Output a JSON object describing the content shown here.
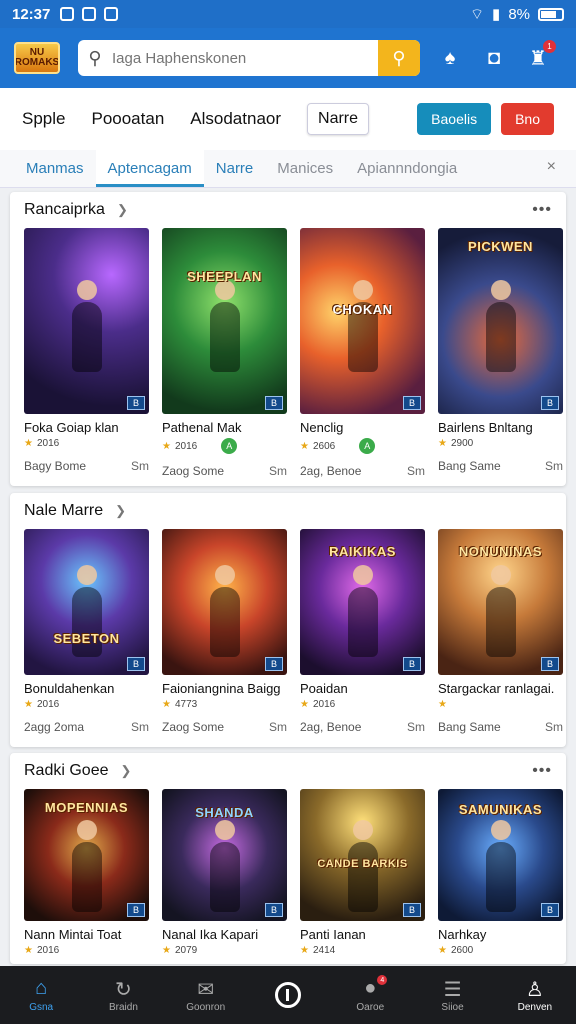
{
  "status_bar": {
    "time": "12:37",
    "battery": "8%"
  },
  "header": {
    "logo_text": "NU ROMAKS",
    "search_placeholder": "Iaga Haphenskonen",
    "icons": [
      "bell-icon",
      "notification-icon",
      "profile-icon"
    ],
    "profile_badge": "1"
  },
  "top_nav": {
    "links": [
      "Spple",
      "Poooatan",
      "Alsodatnaor"
    ],
    "outline_link": "Narre",
    "button_a": "Baoelis",
    "button_b": "Bno"
  },
  "tabs": {
    "items": [
      "Manmas",
      "Aptencagam",
      "Narre",
      "Manices",
      "Apiannndongia"
    ],
    "active_index": 1,
    "close": "×"
  },
  "sections": [
    {
      "title": "Rancaiprka",
      "cards": [
        {
          "title": "Foka Goiap klan",
          "year": "2016",
          "meta": "Bagy Bome",
          "size": "Sm",
          "corner": "B",
          "chip": "",
          "art_title": ""
        },
        {
          "title": "Pathenal Mak",
          "year": "2016",
          "meta": "Zaog Some",
          "size": "Sm",
          "corner": "B",
          "chip": "A",
          "art_title": "SHEEPLAN"
        },
        {
          "title": "Nenclig",
          "year": "2606",
          "meta": "2ag, Benoe",
          "size": "Sm",
          "corner": "B",
          "chip": "A",
          "art_title": "CHOKAN"
        },
        {
          "title": "Bairlens Bnltang",
          "year": "2900",
          "meta": "Bang Same",
          "size": "Sm",
          "corner": "B",
          "chip": "",
          "art_title": "PICKWEN"
        }
      ]
    },
    {
      "title": "Nale Marre",
      "cards": [
        {
          "title": "Bonuldahenkan",
          "year": "2016",
          "meta": "2agg 2oma",
          "size": "Sm",
          "corner": "B",
          "chip": "",
          "art_title": "SEBETON"
        },
        {
          "title": "Faioniangnina Baigg",
          "year": "4773",
          "meta": "Zaog Some",
          "size": "Sm",
          "corner": "B",
          "chip": "",
          "art_title": ""
        },
        {
          "title": "Poaidan",
          "year": "2016",
          "meta": "2ag, Benoe",
          "size": "Sm",
          "corner": "B",
          "chip": "",
          "art_title": "RAIKIKAS"
        },
        {
          "title": "Stargackar ranlagai.",
          "year": "",
          "meta": "Bang Same",
          "size": "Sm",
          "corner": "B",
          "chip": "",
          "art_title": "NONUNINAS"
        }
      ]
    },
    {
      "title": "Radki Goee",
      "cards": [
        {
          "title": "Nann Mintai Toat",
          "year": "2016",
          "meta": "",
          "size": "",
          "corner": "B",
          "chip": "",
          "art_title": "MOPENNIAS"
        },
        {
          "title": "Nanal Ika Kapari",
          "year": "2079",
          "meta": "",
          "size": "",
          "corner": "B",
          "chip": "",
          "art_title": "SHANDA"
        },
        {
          "title": "Panti Ianan",
          "year": "2414",
          "meta": "",
          "size": "",
          "corner": "B",
          "chip": "",
          "art_title": "CANDE BARKIS"
        },
        {
          "title": "Narhkay",
          "year": "2600",
          "meta": "",
          "size": "",
          "corner": "B",
          "chip": "",
          "art_title": "SAMUNIKAS"
        }
      ]
    }
  ],
  "bottom_nav": [
    {
      "label": "Gsna",
      "icon": "home-icon"
    },
    {
      "label": "Braidn",
      "icon": "refresh-icon"
    },
    {
      "label": "Goonron",
      "icon": "chat-icon"
    },
    {
      "label": "",
      "icon": "power-icon"
    },
    {
      "label": "Oaroe",
      "icon": "message-icon",
      "badge": "4"
    },
    {
      "label": "Siioe",
      "icon": "menu-icon"
    },
    {
      "label": "Denven",
      "icon": "user-icon"
    }
  ],
  "colors": {
    "header_blue": "#1f74d0",
    "search_button": "#f3b51c",
    "button_a": "#168dbb",
    "button_b": "#e23b2e",
    "active_tab": "#2a8fc6",
    "bottom_active": "#3ea1ef"
  }
}
